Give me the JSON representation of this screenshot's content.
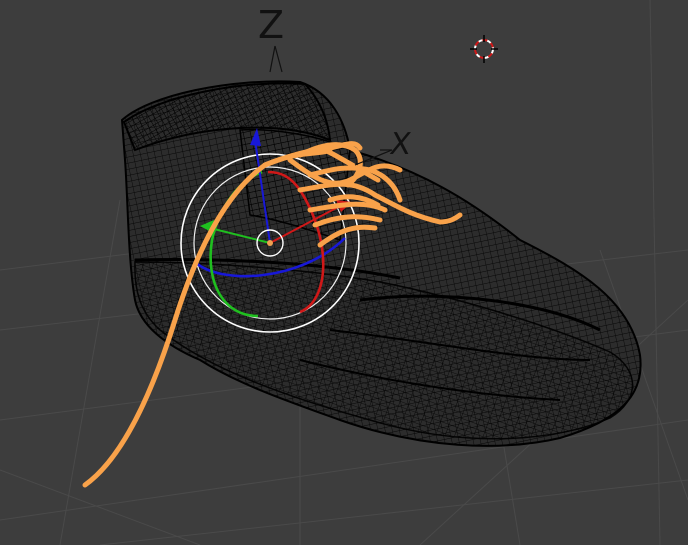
{
  "viewport": {
    "background": "#3d3d3d",
    "grid_color": "#4a4a4a",
    "axis_labels": {
      "z": "Z",
      "x": "X"
    },
    "object": "shoe-wireframe",
    "selected_object": "shoelace",
    "selected_color": "#f9a24a",
    "manipulator_colors": {
      "x": "#d01818",
      "y": "#1fbf1f",
      "z": "#1818d8",
      "view": "#ffffff"
    },
    "icons": [
      "3d-cursor-icon",
      "rotate-manipulator-icon",
      "object-origin-icon"
    ]
  }
}
